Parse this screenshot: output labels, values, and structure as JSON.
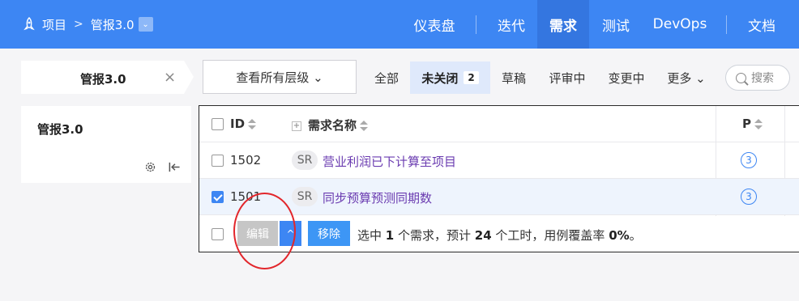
{
  "topbar": {
    "project": "项目",
    "separator": ">",
    "current": "管报3.0",
    "caret": "⌄",
    "nav": [
      {
        "label": "仪表盘"
      },
      {
        "label": "迭代"
      },
      {
        "label": "需求"
      },
      {
        "label": "测试"
      },
      {
        "label": "DevOps"
      },
      {
        "label": "文档"
      }
    ],
    "active_nav": "需求"
  },
  "toolbar": {
    "crumb_title": "管报3.0",
    "close_glyph": "×",
    "level_select": "查看所有层级 ⌄",
    "filters": [
      {
        "label": "全部"
      },
      {
        "label": "未关闭",
        "count": "2"
      },
      {
        "label": "草稿"
      },
      {
        "label": "评审中"
      },
      {
        "label": "变更中"
      },
      {
        "label": "更多 ⌄"
      }
    ],
    "search_placeholder": "搜索"
  },
  "sidebar": {
    "title": "管报3.0"
  },
  "table": {
    "headers": {
      "id": "ID",
      "name": "需求名称",
      "priority": "P",
      "plus": "+"
    },
    "rows": [
      {
        "id": "1502",
        "type": "SR",
        "name": "营业利润已下计算至项目",
        "priority": "3",
        "checked": false
      },
      {
        "id": "1501",
        "type": "SR",
        "name": "同步预算预测同期数",
        "priority": "3",
        "checked": true
      }
    ]
  },
  "bulk": {
    "edit": "编辑",
    "caret": "^",
    "remove": "移除",
    "s1": "选中 ",
    "count": "1",
    "s2": " 个需求，预计 ",
    "hours": "24",
    "s3": " 个工时，用例覆盖率 ",
    "coverage": "0%",
    "s4": "。"
  },
  "colors": {
    "brand": "#3d86f3",
    "annotation": "#e2262b"
  }
}
